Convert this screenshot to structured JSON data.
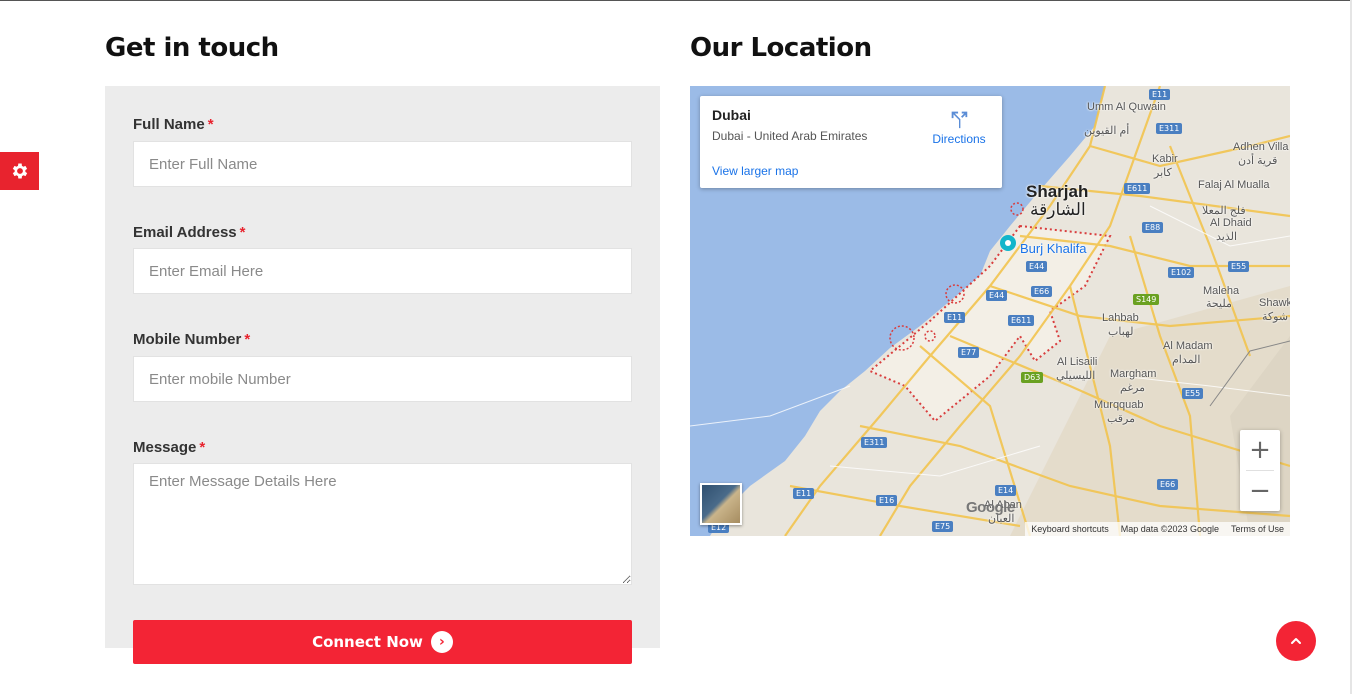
{
  "contact": {
    "title": "Get in touch",
    "fields": [
      {
        "label": "Full Name",
        "required_mark": "*",
        "placeholder": "Enter Full Name",
        "value": ""
      },
      {
        "label": "Email Address",
        "required_mark": "*",
        "placeholder": "Enter Email Here",
        "value": ""
      },
      {
        "label": "Mobile Number",
        "required_mark": "*",
        "placeholder": "Enter mobile Number",
        "value": ""
      },
      {
        "label": "Message",
        "required_mark": "*",
        "placeholder": "Enter Message Details Here",
        "value": ""
      }
    ],
    "submit_label": "Connect Now",
    "submit_icon": "chevron-right-icon"
  },
  "location": {
    "title": "Our Location",
    "map": {
      "place_name": "Dubai",
      "place_address": "Dubai - United Arab Emirates",
      "directions_label": "Directions",
      "view_larger_label": "View larger map",
      "city_labels": {
        "sharjah": "Sharjah",
        "sharjah_ar": "الشارقة",
        "burj_khalifa": "Burj Khalifa",
        "umm_al_quwain": "Umm Al Quwain",
        "umm_al_quwain_ar": "أم القيوين",
        "kabir": "Kabir",
        "kabir_ar": "كابر",
        "adhen": "Adhen Villa",
        "adhen_ar": "قرية أدن",
        "falaj": "Falaj Al Mualla",
        "falaj_ar": "فلج المعلا",
        "al_dhaid": "Al Dhaid",
        "al_dhaid_ar": "الذيد",
        "maleha": "Maleha",
        "maleha_ar": "مليحة",
        "shawka": "Shawka",
        "shawka_ar": "شوكة",
        "lahbab": "Lahbab",
        "lahbab_ar": "لهباب",
        "al_madam": "Al Madam",
        "al_madam_ar": "المدام",
        "al_lisaili": "Al Lisaili",
        "al_lisaili_ar": "الليسيلي",
        "margham": "Margham",
        "margham_ar": "مرغم",
        "murqquab": "Murqquab",
        "murqquab_ar": "مرقب",
        "al_aban": "Al Aban",
        "al_aban_ar": "العبان"
      },
      "road_shields": {
        "e11_top": "E11",
        "e311_top": "E311",
        "e611_top": "E611",
        "e88": "E88",
        "e102": "E102",
        "e55_top": "E55",
        "e44_a": "E44",
        "e66_a": "E66",
        "e44_b": "E44",
        "e11_mid": "E11",
        "e611_mid": "E611",
        "e77": "E77",
        "s149": "S149",
        "d63": "D63",
        "e55_mid": "E55",
        "e311_low": "E311",
        "e11_low": "E11",
        "e16": "E16",
        "e14": "E14",
        "e66_low": "E66",
        "e75": "E75",
        "e12": "E12"
      },
      "zoom_in": "+",
      "zoom_out": "−",
      "google_logo": "Google",
      "attribution": {
        "shortcuts": "Keyboard shortcuts",
        "map_data": "Map data ©2023 Google",
        "terms": "Terms of Use"
      }
    }
  },
  "colors": {
    "accent": "#f32435",
    "link": "#1a73e8",
    "panel": "#ececec"
  },
  "settings_tab_icon": "gear-icon",
  "scroll_top_icon": "chevron-up-icon"
}
